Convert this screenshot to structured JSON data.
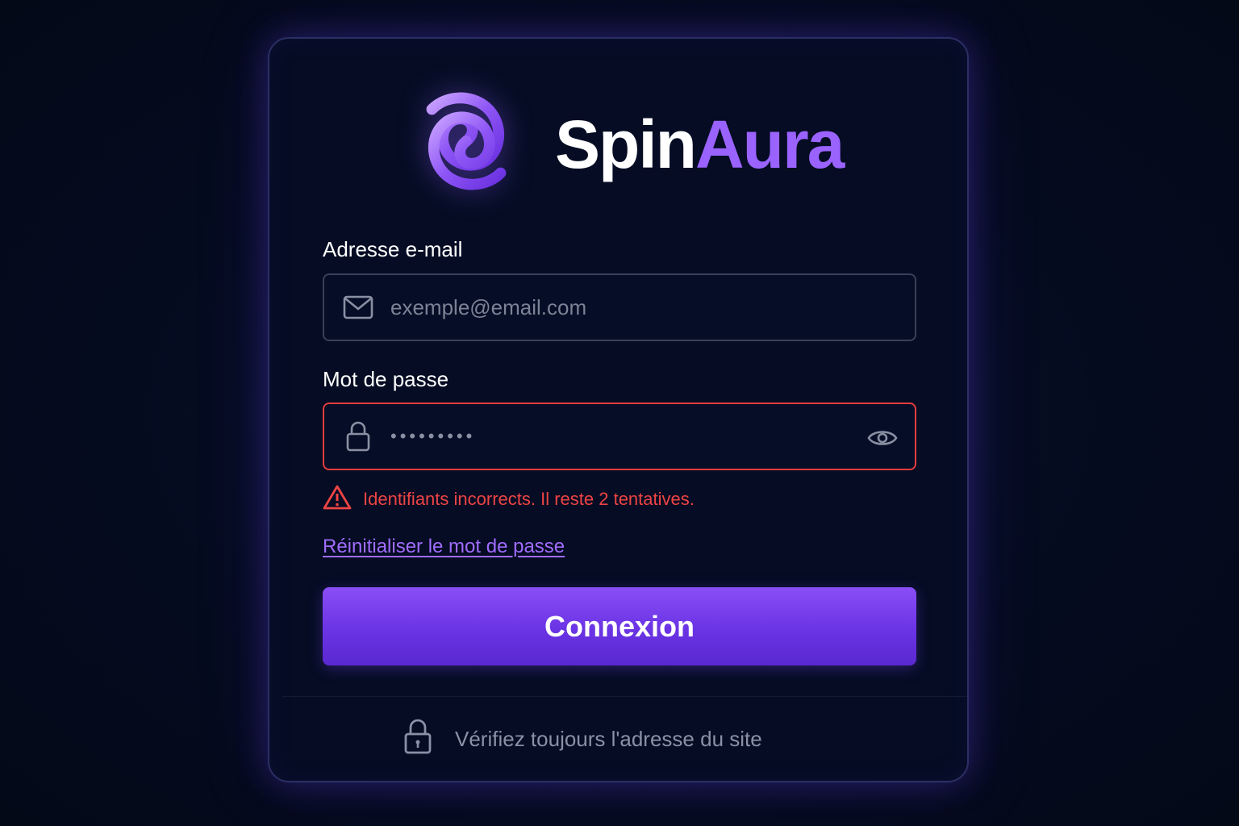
{
  "brand": {
    "name_part1": "Spin",
    "name_part2": "Aura",
    "logo_icon": "spiral-icon",
    "accent": "#9a63ff"
  },
  "email": {
    "label": "Adresse e-mail",
    "placeholder": "exemple@email.com",
    "icon": "envelope-icon"
  },
  "password": {
    "label": "Mot de passe",
    "masked_value": "•••••••••",
    "icon": "lock-icon",
    "toggle_icon": "eye-icon",
    "border_color": "#e23d3d"
  },
  "error": {
    "message": "Identifiants incorrects. Il reste 2 tentatives.",
    "icon": "warning-icon",
    "color": "#ee4444"
  },
  "reset_link": "Réinitialiser le mot de passe",
  "submit_label": "Connexion",
  "footer": {
    "text": "Vérifiez toujours l'adresse du site",
    "icon": "lock-icon"
  }
}
